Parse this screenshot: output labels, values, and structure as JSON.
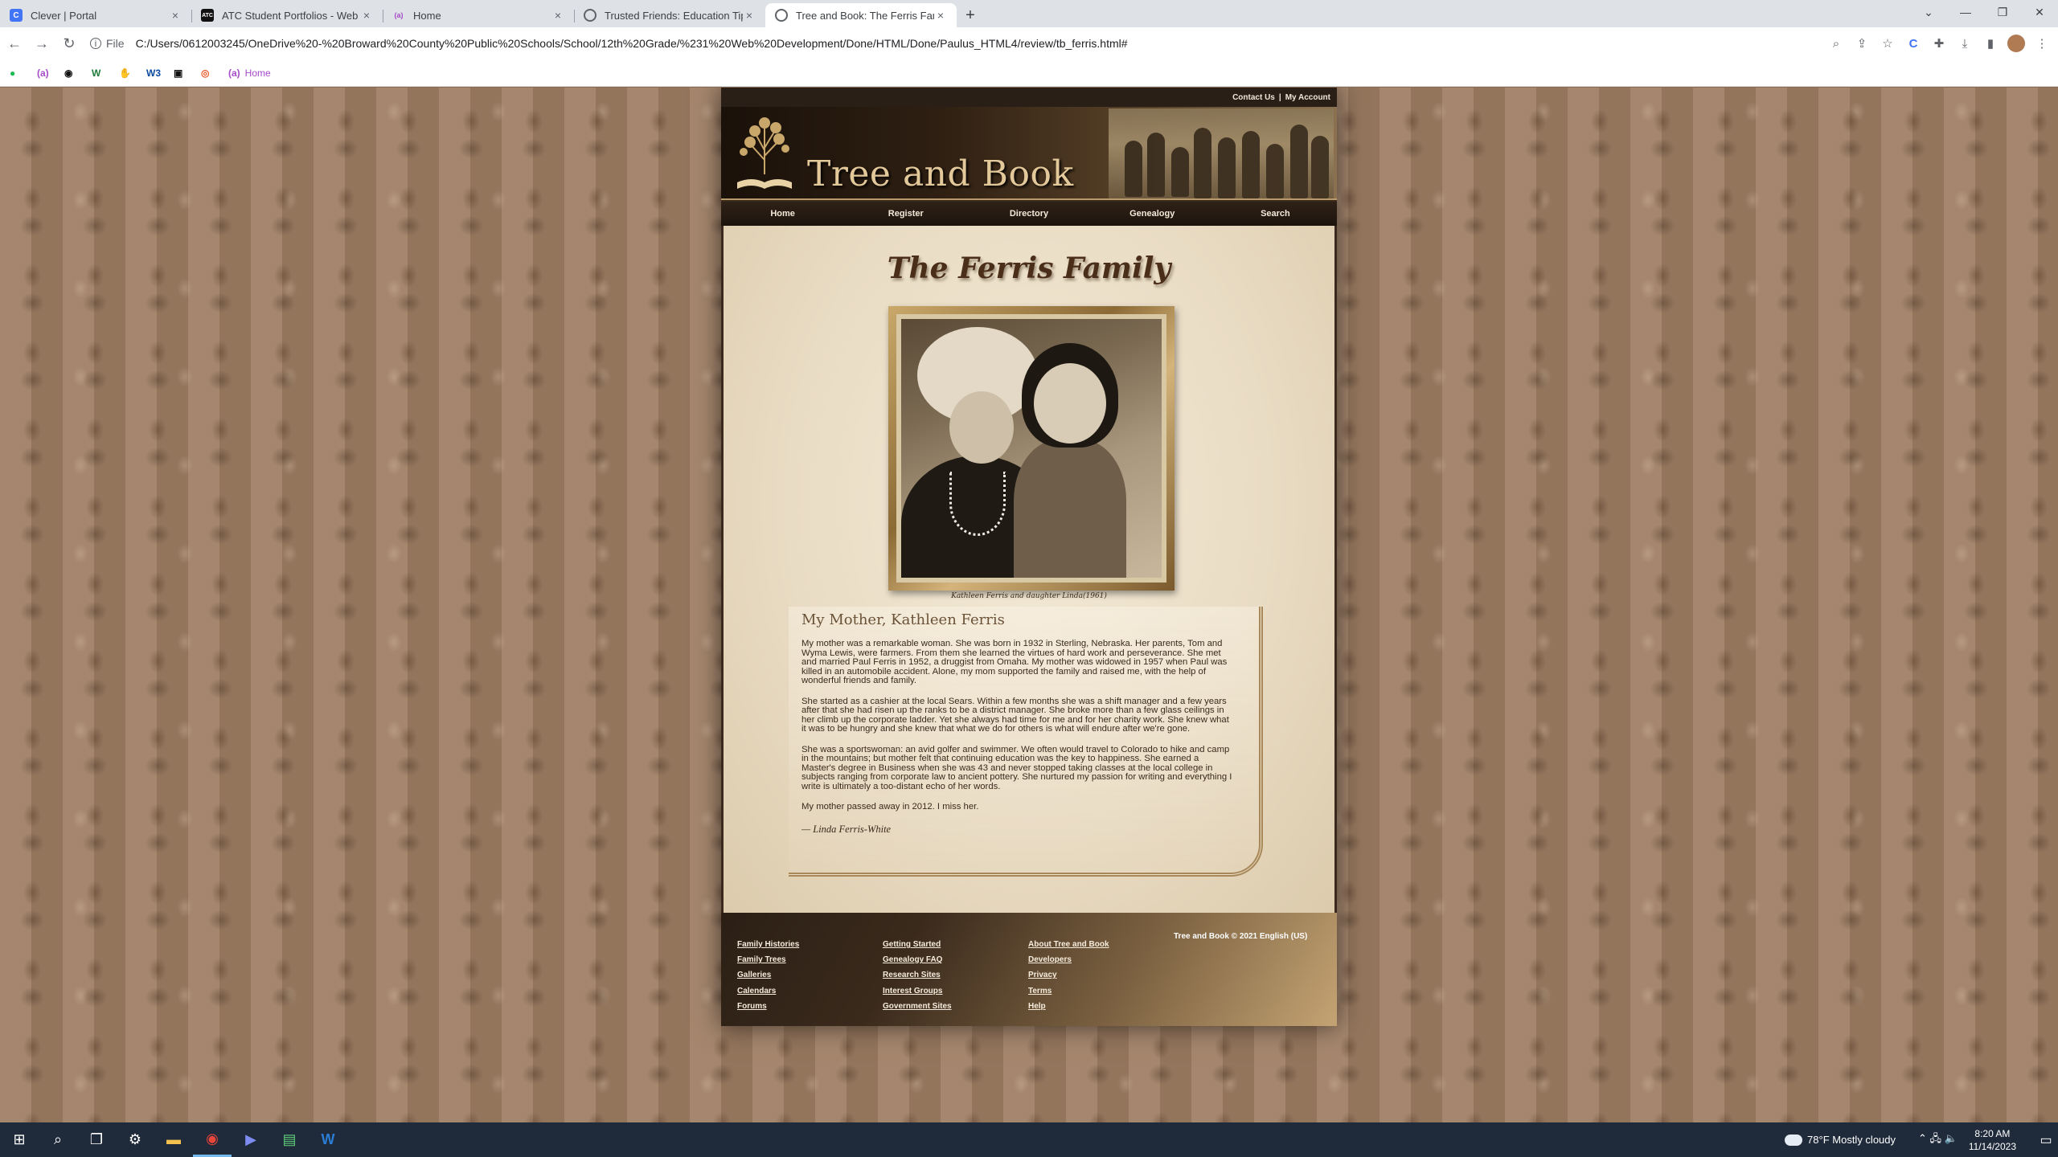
{
  "browser": {
    "tabs": [
      {
        "title": "Clever | Portal",
        "favicon": "clever-icon",
        "color": "#4274f6",
        "glyph": "C"
      },
      {
        "title": "ATC Student Portfolios - Web De",
        "favicon": "atc-icon",
        "color": "#111111",
        "glyph": "ATC"
      },
      {
        "title": "Home",
        "favicon": "home-icon",
        "color": "#a64ac9",
        "glyph": "(a)"
      },
      {
        "title": "Trusted Friends: Education Tips",
        "favicon": "globe-icon",
        "color": "#5f6368",
        "glyph": ""
      },
      {
        "title": "Tree and Book: The Ferris Family",
        "favicon": "globe-icon",
        "color": "#5f6368",
        "glyph": ""
      }
    ],
    "close_glyph": "×",
    "new_tab_glyph": "+",
    "url_scheme": "File",
    "url": "C:/Users/0612003245/OneDrive%20-%20Broward%20County%20Public%20Schools/School/12th%20Grade/%231%20Web%20Development/Done/HTML/Done/Paulus_HTML4/review/tb_ferris.html#",
    "bookmarks": [
      {
        "icon": "spotify-icon",
        "glyph": "●",
        "color": "#1db954"
      },
      {
        "icon": "a-icon",
        "glyph": "(a)",
        "color": "#a64ac9"
      },
      {
        "icon": "github-icon",
        "glyph": "◉",
        "color": "#111111"
      },
      {
        "icon": "w-icon",
        "glyph": "W",
        "color": "#1f7a3a"
      },
      {
        "icon": "hand-icon",
        "glyph": "✋",
        "color": "#e8a13a"
      },
      {
        "icon": "w3-icon",
        "glyph": "W3",
        "color": "#0b4aa0"
      },
      {
        "icon": "pixel-icon",
        "glyph": "▣",
        "color": "#111111"
      },
      {
        "icon": "orange-icon",
        "glyph": "◎",
        "color": "#e5582a"
      },
      {
        "icon": "a-icon",
        "glyph": "(a)",
        "color": "#a64ac9",
        "label": "Home"
      }
    ]
  },
  "site": {
    "top_links": [
      "Contact Us",
      "My Account"
    ],
    "logo": "Tree and Book",
    "nav": [
      "Home",
      "Register",
      "Directory",
      "Genealogy",
      "Search"
    ],
    "page_title": "The Ferris Family",
    "caption": "Kathleen Ferris and daughter Linda(1961)",
    "article": {
      "heading": "My Mother, Kathleen Ferris",
      "paragraphs": [
        "My mother was a remarkable woman. She was born in 1932 in Sterling, Nebraska. Her parents, Tom and Wyma Lewis, were farmers. From them she learned the virtues of hard work and perseverance. She met and married Paul Ferris in 1952, a druggist from Omaha. My mother was widowed in 1957 when Paul was killed in an automobile accident. Alone, my mom supported the family and raised me, with the help of wonderful friends and family.",
        "She started as a cashier at the local Sears. Within a few months she was a shift manager and a few years after that she had risen up the ranks to be a district manager. She broke more than a few glass ceilings in her climb up the corporate ladder. Yet she always had time for me and for her charity work. She knew what it was to be hungry and she knew that what we do for others is what will endure after we're gone.",
        "She was a sportswoman: an avid golfer and swimmer. We often would travel to Colorado to hike and camp in the mountains; but mother felt that continuing education was the key to happiness. She earned a Master's degree in Business when she was 43 and never stopped taking classes at the local college in subjects ranging from corporate law to ancient pottery. She nurtured my passion for writing and everything I write is ultimately a too-distant echo of her words.",
        "My mother passed away in 2012. I miss her."
      ],
      "signature": "— Linda Ferris-White"
    },
    "footer": {
      "col1": [
        "Family Histories",
        "Family Trees",
        "Galleries",
        "Calendars",
        "Forums"
      ],
      "col2": [
        "Getting Started",
        "Genealogy FAQ",
        "Research Sites",
        "Interest Groups",
        "Government Sites"
      ],
      "col3": [
        "About Tree and Book",
        "Developers",
        "Privacy",
        "Terms",
        "Help"
      ],
      "copyright": "Tree and Book © 2021 English (US)"
    }
  },
  "taskbar": {
    "weather": "78°F  Mostly cloudy",
    "time": "8:20 AM",
    "date": "11/14/2023"
  }
}
